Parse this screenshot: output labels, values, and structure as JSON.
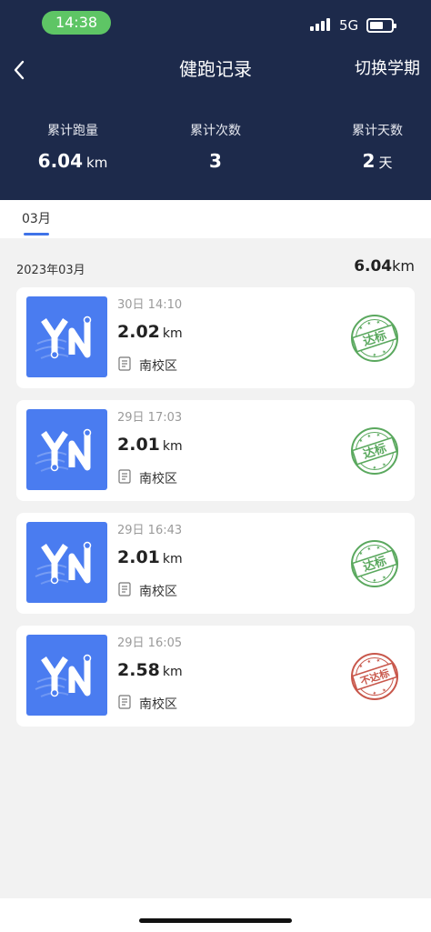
{
  "status_bar": {
    "time": "14:38",
    "network": "5G"
  },
  "nav": {
    "title": "健跑记录",
    "switch_label": "切换学期"
  },
  "stats": [
    {
      "label": "累计跑量",
      "value": "6.04",
      "unit": "km"
    },
    {
      "label": "累计次数",
      "value": "3",
      "unit": ""
    },
    {
      "label": "累计天数",
      "value": "2",
      "unit": "天"
    }
  ],
  "tabs": [
    {
      "label": "03月",
      "active": true
    }
  ],
  "month": {
    "label": "2023年03月",
    "total_value": "6.04",
    "total_unit": "km"
  },
  "records": [
    {
      "time": "30日 14:10",
      "distance": "2.02",
      "unit": "km",
      "campus": "南校区",
      "status": "达标",
      "status_color": "#5aa85e"
    },
    {
      "time": "29日 17:03",
      "distance": "2.01",
      "unit": "km",
      "campus": "南校区",
      "status": "达标",
      "status_color": "#5aa85e"
    },
    {
      "time": "29日 16:43",
      "distance": "2.01",
      "unit": "km",
      "campus": "南校区",
      "status": "达标",
      "status_color": "#5aa85e"
    },
    {
      "time": "29日 16:05",
      "distance": "2.58",
      "unit": "km",
      "campus": "南校区",
      "status": "不达标",
      "status_color": "#c8574b"
    }
  ],
  "colors": {
    "header_bg": "#1d2a4b",
    "accent": "#3f73e8",
    "logo_bg": "#4a7cf0"
  }
}
